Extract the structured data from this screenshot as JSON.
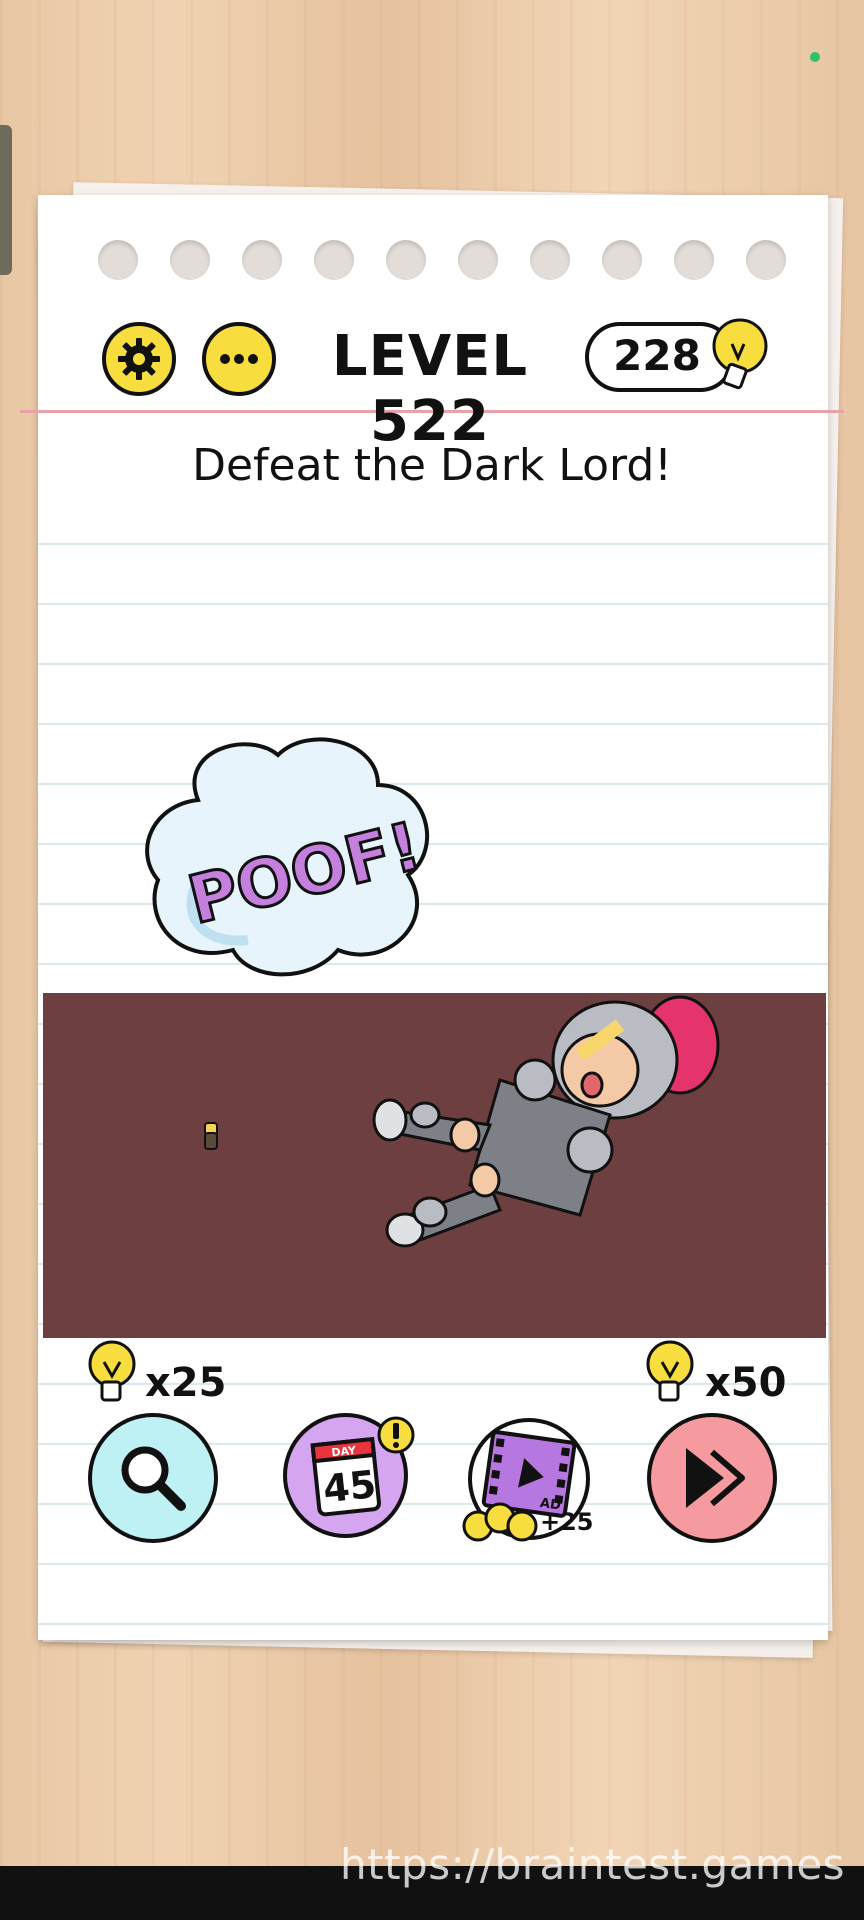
{
  "header": {
    "level_label": "LEVEL 522",
    "hint_count": "228"
  },
  "puzzle": {
    "instruction": "Defeat the Dark Lord!",
    "poof_text": "POOF!"
  },
  "actions": {
    "search_cost": "x25",
    "day_number": "45",
    "day_label": "DAY",
    "ad_label": "AD",
    "ad_bonus": "+25",
    "skip_cost": "x50"
  },
  "watermark": {
    "url": "https://braintest.games"
  },
  "colors": {
    "button_yellow": "#f7dd3e",
    "stage_floor": "#6e3f40",
    "search_bg": "#bdf1f3",
    "day_bg": "#d6a5f0",
    "skip_bg": "#f59b9f",
    "poof_purple": "#c57fdc"
  },
  "icons": [
    "gear-icon",
    "more-icon",
    "lightbulb-icon",
    "search-icon",
    "calendar-icon",
    "film-icon",
    "skip-icon"
  ]
}
